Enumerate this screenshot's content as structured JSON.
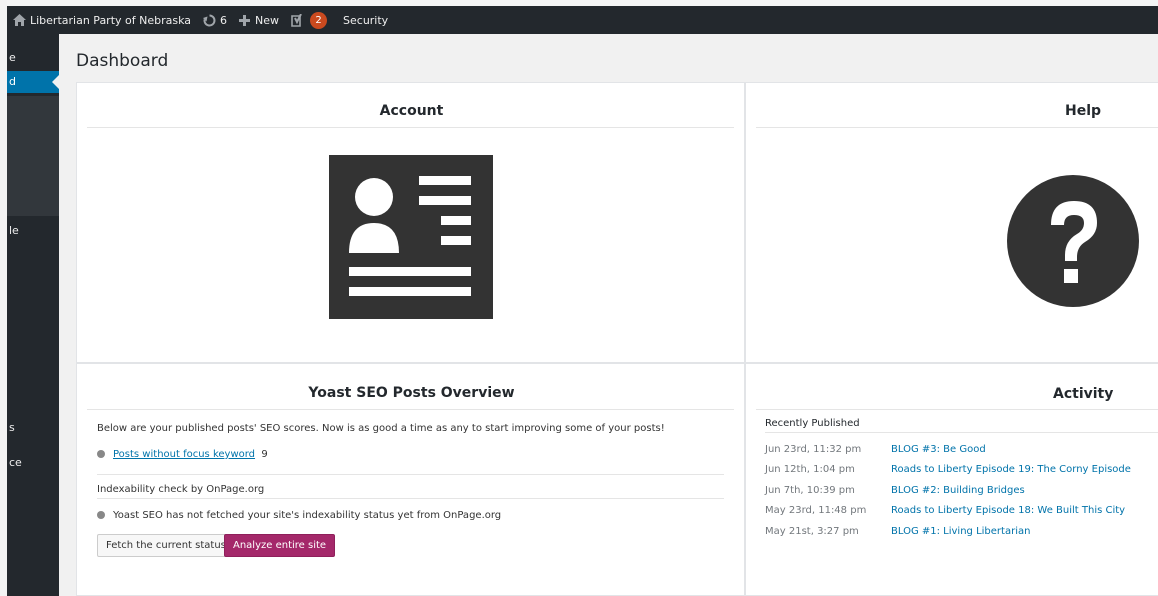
{
  "admin_bar": {
    "site_name": "Libertarian Party of Nebraska",
    "updates_count": "6",
    "new_label": "New",
    "notifications_count": "2",
    "security_label": "Security"
  },
  "sidebar": {
    "items": [
      {
        "label": "e"
      },
      {
        "label": "d"
      },
      {
        "label": "le"
      },
      {
        "label": "s"
      },
      {
        "label": "ce"
      }
    ]
  },
  "page": {
    "title": "Dashboard"
  },
  "account": {
    "title": "Account"
  },
  "help": {
    "title": "Help"
  },
  "yoast": {
    "title": "Yoast SEO Posts Overview",
    "intro": "Below are your published posts' SEO scores. Now is as good a time as any to start improving some of your posts!",
    "posts_link": "Posts without focus keyword",
    "posts_count": "9",
    "indexability_heading": "Indexability check by OnPage.org",
    "indexability_status": "Yoast SEO has not fetched your site's indexability status yet from OnPage.org",
    "fetch_button": "Fetch the current status",
    "analyze_button": "Analyze entire site"
  },
  "activity": {
    "title": "Activity",
    "recent_label": "Recently Published",
    "items": [
      {
        "date": "Jun 23rd, 11:32 pm",
        "title": "BLOG #3: Be Good"
      },
      {
        "date": "Jun 12th, 1:04 pm",
        "title": "Roads to Liberty Episode 19: The Corny Episode"
      },
      {
        "date": "Jun 7th, 10:39 pm",
        "title": "BLOG #2: Building Bridges"
      },
      {
        "date": "May 23rd, 11:48 pm",
        "title": "Roads to Liberty Episode 18: We Built This City"
      },
      {
        "date": "May 21st, 3:27 pm",
        "title": "BLOG #1: Living Libertarian"
      }
    ]
  },
  "colors": {
    "admin_bar": "#23282d",
    "active_menu": "#0073aa",
    "link": "#0073aa",
    "analyze_button": "#a4286a",
    "badge": "#ca4a1f"
  }
}
